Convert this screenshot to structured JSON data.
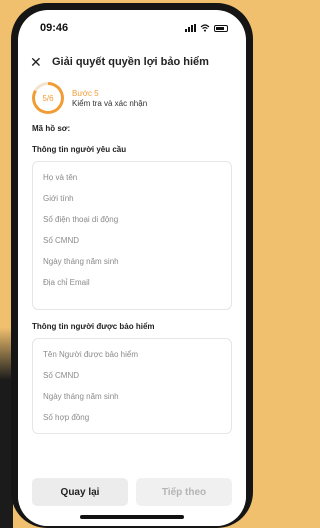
{
  "status_bar": {
    "time": "09:46"
  },
  "header": {
    "title": "Giải quyết quyền lợi bảo hiểm",
    "close_icon": "close-icon"
  },
  "stepper": {
    "progress": "5/6",
    "fraction": 0.833,
    "step_name": "Bước 5",
    "step_desc": "Kiểm tra và xác nhận"
  },
  "file_label": "Mã hồ sơ:",
  "requester": {
    "title": "Thông tin người yêu cầu",
    "fields": [
      "Họ và tên",
      "Giới tính",
      "Số điện thoại di động",
      "Số CMND",
      "Ngày tháng năm sinh",
      "Địa chỉ Email"
    ]
  },
  "insured": {
    "title": "Thông tin người được bảo hiểm",
    "fields": [
      "Tên Người được bảo hiểm",
      "Số CMND",
      "Ngày tháng năm sinh",
      "Số hợp đồng"
    ]
  },
  "footer": {
    "back_label": "Quay lại",
    "next_label": "Tiếp theo"
  },
  "colors": {
    "accent": "#f29c35",
    "background": "#f0c06e"
  }
}
